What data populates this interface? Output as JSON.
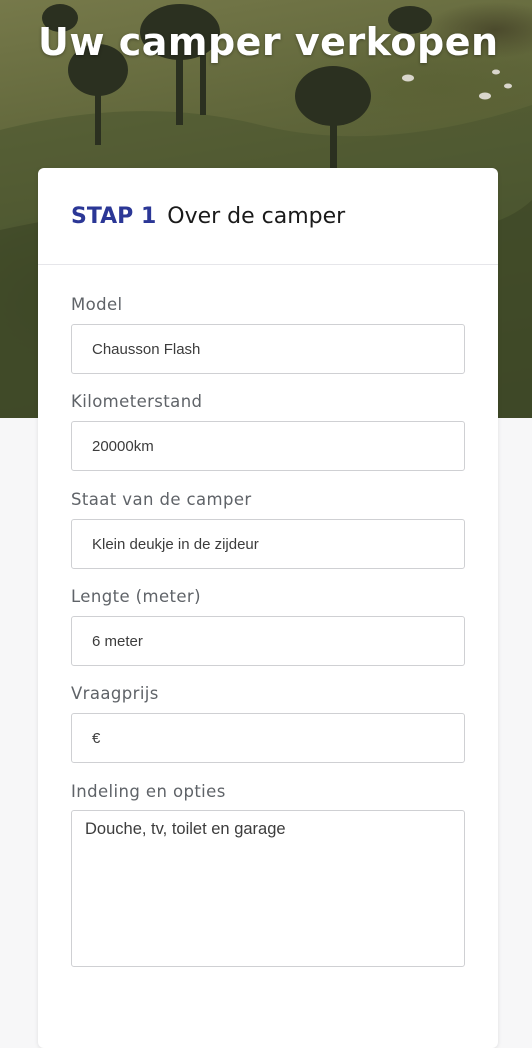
{
  "hero": {
    "title": "Uw camper verkopen"
  },
  "step": {
    "number": "STAP 1",
    "title": "Over de camper"
  },
  "fields": [
    {
      "label": "Model",
      "value": "Chausson Flash"
    },
    {
      "label": "Kilometerstand",
      "value": "20000km"
    },
    {
      "label": "Staat van de camper",
      "value": "Klein deukje in de zijdeur"
    },
    {
      "label": "Lengte (meter)",
      "value": "6 meter"
    },
    {
      "label": "Vraagprijs",
      "value": "€"
    },
    {
      "label": "Indeling en opties",
      "value": "Douche, tv, toilet en garage"
    }
  ],
  "colors": {
    "accent": "#2b3796",
    "label": "#5f6368",
    "border": "#cfd0d3"
  }
}
